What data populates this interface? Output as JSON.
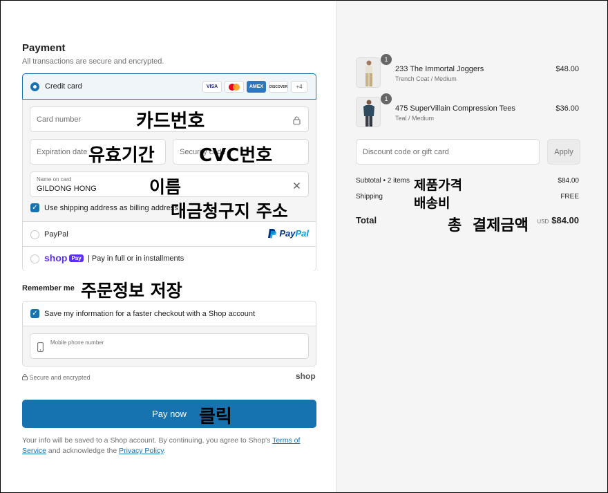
{
  "payment": {
    "title": "Payment",
    "subtitle": "All transactions are secure and encrypted.",
    "credit_card_label": "Credit card",
    "card_brands": [
      "VISA",
      "AMEX",
      "DISCOVER"
    ],
    "more_cards": "+4",
    "card_number_placeholder": "Card number",
    "expiration_placeholder": "Expiration date",
    "security_placeholder": "Security code",
    "name_label": "Name on card",
    "name_value": "GILDONG HONG",
    "billing_checkbox_label": "Use shipping address as billing address",
    "billing_checked": true,
    "paypal_label": "PayPal",
    "paypal_logo_a": "Pay",
    "paypal_logo_b": "Pal",
    "shop_logo": "shop",
    "shop_pay_badge": "Pay",
    "shop_pay_text": "| Pay in full or in installments"
  },
  "remember": {
    "title": "Remember me",
    "save_label": "Save my information for a faster checkout with a Shop account",
    "save_checked": true,
    "phone_label": "Mobile phone number"
  },
  "footer": {
    "secure_text": "Secure and encrypted",
    "shop_logo": "shop",
    "pay_now": "Pay now",
    "legal_prefix": "Your info will be saved to a Shop account. By continuing, you agree to Shop's ",
    "terms_link": "Terms of Service",
    "legal_mid": " and acknowledge the ",
    "privacy_link": "Privacy Policy",
    "legal_end": "."
  },
  "annotations": {
    "card_number": "카드번호",
    "expiry": "유효기간",
    "cvc": "CVC번호",
    "name": "이름",
    "billing": "대금청구지 주소",
    "remember": "주문정보 저장",
    "click": "클릭",
    "product_price": "제품가격",
    "shipping": "배송비",
    "total": "총 결제금액"
  },
  "order": {
    "items": [
      {
        "qty": "1",
        "name": "233 The Immortal Joggers",
        "variant": "Trench Coat / Medium",
        "price": "$48.00"
      },
      {
        "qty": "1",
        "name": "475 SuperVillain Compression Tees",
        "variant": "Teal / Medium",
        "price": "$36.00"
      }
    ],
    "discount_placeholder": "Discount code or gift card",
    "apply_label": "Apply",
    "subtotal_label": "Subtotal • 2 items",
    "subtotal_value": "$84.00",
    "shipping_label": "Shipping",
    "shipping_value": "FREE",
    "total_label": "Total",
    "total_currency": "USD",
    "total_value": "$84.00"
  },
  "colors": {
    "accent": "#1773b0",
    "shop_purple": "#5a31f4",
    "paypal_dark": "#003087",
    "paypal_light": "#009cde"
  }
}
